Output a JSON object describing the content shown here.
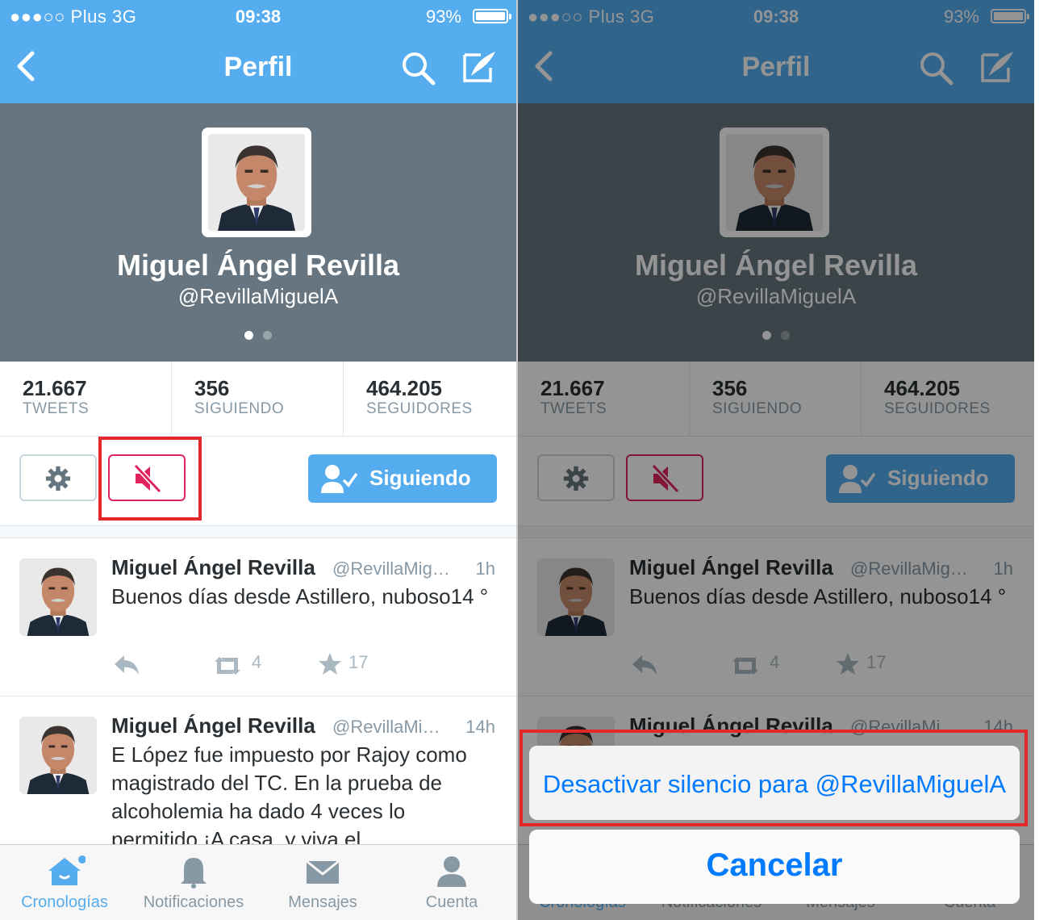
{
  "status": {
    "carrier": "●●●○○ Plus   3G",
    "time": "09:38",
    "battery": "93%"
  },
  "nav": {
    "title": "Perfil"
  },
  "profile": {
    "name": "Miguel Ángel Revilla",
    "handle": "@RevillaMiguelA"
  },
  "stats": [
    {
      "value": "21.667",
      "label": "TWEETS"
    },
    {
      "value": "356",
      "label": "SIGUIENDO"
    },
    {
      "value": "464.205",
      "label": "SEGUIDORES"
    }
  ],
  "actions": {
    "follow_label": "Siguiendo"
  },
  "tweets": [
    {
      "name": "Miguel Ángel Revilla",
      "handle": "@RevillaMig…",
      "time": "1h",
      "text": "Buenos días desde Astillero, nuboso14 °",
      "retweets": "4",
      "favorites": "17"
    },
    {
      "name": "Miguel Ángel Revilla",
      "handle": "@RevillaMi…",
      "time": "14h",
      "text": "E López fue impuesto por Rajoy como magistrado del TC. En la prueba de alcoholemia ha dado 4 veces lo permitido ¡A casa, y viva el",
      "retweets": "",
      "favorites": ""
    }
  ],
  "tabs": [
    {
      "label": "Cronologías",
      "icon": "home-icon"
    },
    {
      "label": "Notificaciones",
      "icon": "bell-icon"
    },
    {
      "label": "Mensajes",
      "icon": "envelope-icon"
    },
    {
      "label": "Cuenta",
      "icon": "person-icon"
    }
  ],
  "action_sheet": {
    "unmute_label": "Desactivar silencio para @RevillaMiguelA",
    "cancel_label": "Cancelar"
  },
  "colors": {
    "twitter_blue": "#55acee",
    "header_gray": "#66757f",
    "mute_red": "#e0245e",
    "highlight_red": "#e4282a",
    "ios_blue": "#007aff"
  }
}
